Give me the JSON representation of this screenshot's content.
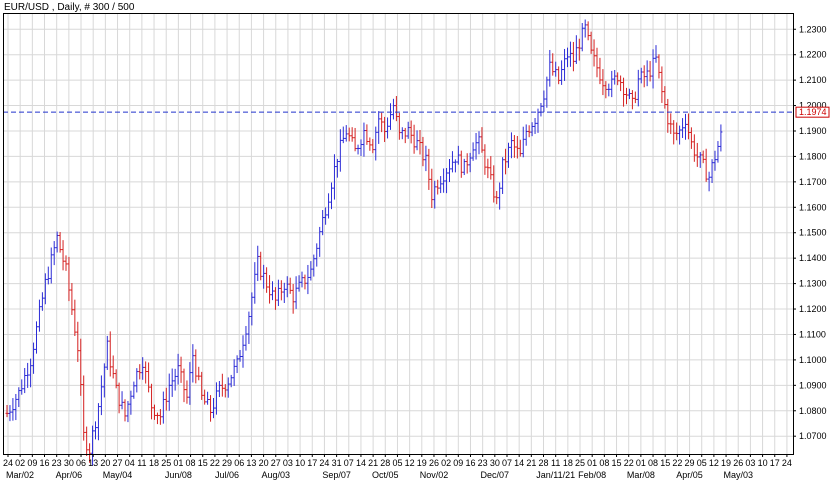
{
  "header": {
    "title": "EUR/USD , Daily, # 300 / 500"
  },
  "chart_data": {
    "type": "ohlc",
    "title": "EUR/USD , Daily, # 300 / 500",
    "ylim": [
      1.063,
      1.236
    ],
    "y_ticks": [
      "1.2300",
      "1.2200",
      "1.2100",
      "1.2000",
      "1.1900",
      "1.1800",
      "1.1700",
      "1.1600",
      "1.1500",
      "1.1400",
      "1.1300",
      "1.1200",
      "1.1100",
      "1.1000",
      "1.0900",
      "1.0800",
      "1.0700"
    ],
    "x_day_ticks": [
      "24",
      "02",
      "09",
      "16",
      "23",
      "30",
      "06",
      "13",
      "20",
      "27",
      "04",
      "11",
      "18",
      "25",
      "01",
      "08",
      "15",
      "22",
      "29",
      "06",
      "13",
      "20",
      "27",
      "03",
      "10",
      "17",
      "24",
      "31",
      "07",
      "14",
      "21",
      "28",
      "05",
      "12",
      "19",
      "26",
      "02",
      "09",
      "16",
      "23",
      "30",
      "07",
      "14",
      "21",
      "28",
      "11",
      "18",
      "25",
      "01",
      "08",
      "15",
      "22",
      "01",
      "08",
      "15",
      "22",
      "29",
      "05",
      "12",
      "19",
      "26",
      "03",
      "10",
      "17",
      "24"
    ],
    "x_month_labels": [
      "Mar/02",
      "Apr/06",
      "May/04",
      "Jun/08",
      "Jul/06",
      "Aug/03",
      "Sep/07",
      "Oct/05",
      "Nov/02",
      "Dec/07",
      "Jan/11/21",
      "Feb/08",
      "Mar/08",
      "Apr/05",
      "May/03"
    ],
    "current_price": {
      "value": 1.1974,
      "label": "1.1974",
      "line_color": "#2233cc",
      "box_color": "#cc0000"
    },
    "grid": true,
    "bar_colors": {
      "up": "#2b2bd6",
      "down": "#d42020"
    },
    "path": [
      [
        0,
        1.079
      ],
      [
        4,
        1.087
      ],
      [
        8,
        1.1
      ],
      [
        13,
        1.13
      ],
      [
        17,
        1.148
      ],
      [
        20,
        1.135
      ],
      [
        24,
        1.105
      ],
      [
        26,
        1.07
      ],
      [
        28,
        1.065
      ],
      [
        31,
        1.082
      ],
      [
        34,
        1.105
      ],
      [
        37,
        1.088
      ],
      [
        40,
        1.078
      ],
      [
        43,
        1.092
      ],
      [
        46,
        1.1
      ],
      [
        49,
        1.082
      ],
      [
        52,
        1.078
      ],
      [
        55,
        1.09
      ],
      [
        58,
        1.096
      ],
      [
        61,
        1.085
      ],
      [
        63,
        1.102
      ],
      [
        66,
        1.085
      ],
      [
        69,
        1.08
      ],
      [
        72,
        1.088
      ],
      [
        75,
        1.092
      ],
      [
        78,
        1.098
      ],
      [
        82,
        1.118
      ],
      [
        85,
        1.138
      ],
      [
        88,
        1.13
      ],
      [
        91,
        1.123
      ],
      [
        94,
        1.13
      ],
      [
        97,
        1.125
      ],
      [
        100,
        1.13
      ],
      [
        103,
        1.135
      ],
      [
        106,
        1.15
      ],
      [
        109,
        1.165
      ],
      [
        112,
        1.18
      ],
      [
        115,
        1.19
      ],
      [
        118,
        1.182
      ],
      [
        121,
        1.19
      ],
      [
        124,
        1.185
      ],
      [
        126,
        1.195
      ],
      [
        128,
        1.19
      ],
      [
        131,
        1.2
      ],
      [
        133,
        1.188
      ],
      [
        136,
        1.19
      ],
      [
        139,
        1.185
      ],
      [
        142,
        1.178
      ],
      [
        144,
        1.165
      ],
      [
        146,
        1.17
      ],
      [
        149,
        1.175
      ],
      [
        152,
        1.18
      ],
      [
        155,
        1.175
      ],
      [
        158,
        1.185
      ],
      [
        160,
        1.185
      ],
      [
        162,
        1.178
      ],
      [
        164,
        1.17
      ],
      [
        166,
        1.162
      ],
      [
        168,
        1.176
      ],
      [
        171,
        1.185
      ],
      [
        174,
        1.18
      ],
      [
        176,
        1.19
      ],
      [
        179,
        1.195
      ],
      [
        182,
        1.205
      ],
      [
        184,
        1.215
      ],
      [
        187,
        1.21
      ],
      [
        190,
        1.22
      ],
      [
        192,
        1.218
      ],
      [
        194,
        1.225
      ],
      [
        196,
        1.23
      ],
      [
        198,
        1.22
      ],
      [
        200,
        1.215
      ],
      [
        202,
        1.21
      ],
      [
        205,
        1.208
      ],
      [
        207,
        1.212
      ],
      [
        210,
        1.205
      ],
      [
        212,
        1.2
      ],
      [
        214,
        1.21
      ],
      [
        217,
        1.212
      ],
      [
        220,
        1.218
      ],
      [
        222,
        1.205
      ],
      [
        224,
        1.195
      ],
      [
        226,
        1.188
      ],
      [
        228,
        1.19
      ],
      [
        230,
        1.195
      ],
      [
        232,
        1.185
      ],
      [
        234,
        1.18
      ],
      [
        236,
        1.176
      ],
      [
        238,
        1.172
      ],
      [
        240,
        1.18
      ],
      [
        242,
        1.188
      ],
      [
        244,
        1.195
      ],
      [
        246,
        1.1974
      ]
    ]
  }
}
